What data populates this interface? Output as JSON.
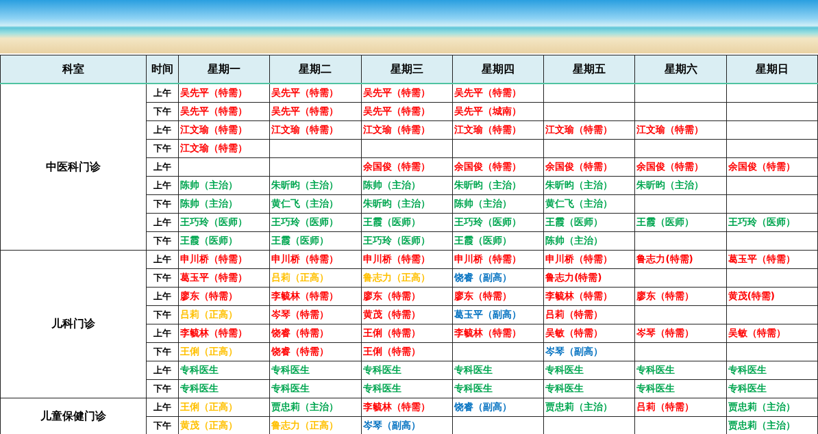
{
  "table": {
    "columns": [
      "科室",
      "时间",
      "星期一",
      "星期二",
      "星期三",
      "星期四",
      "星期五",
      "星期六",
      "星期日"
    ],
    "departments": [
      {
        "name": "中医科门诊",
        "rows": [
          {
            "time": "上午",
            "cells": [
              {
                "text": "吴先平（特需）",
                "color": "#ff0000"
              },
              {
                "text": "吴先平（特需）",
                "color": "#ff0000"
              },
              {
                "text": "吴先平（特需）",
                "color": "#ff0000"
              },
              {
                "text": "吴先平（特需）",
                "color": "#ff0000"
              },
              null,
              null,
              null
            ]
          },
          {
            "time": "下午",
            "cells": [
              {
                "text": "吴先平（特需）",
                "color": "#ff0000"
              },
              {
                "text": "吴先平（特需）",
                "color": "#ff0000"
              },
              {
                "text": "吴先平（特需）",
                "color": "#ff0000"
              },
              {
                "text": "吴先平（城南）",
                "color": "#ff0000"
              },
              null,
              null,
              null
            ]
          },
          {
            "time": "上午",
            "cells": [
              {
                "text": "江文瑜（特需）",
                "color": "#ff0000"
              },
              {
                "text": "江文瑜（特需）",
                "color": "#ff0000"
              },
              {
                "text": "江文瑜（特需）",
                "color": "#ff0000"
              },
              {
                "text": "江文瑜（特需）",
                "color": "#ff0000"
              },
              {
                "text": "江文瑜（特需）",
                "color": "#ff0000"
              },
              {
                "text": "江文瑜（特需）",
                "color": "#ff0000"
              },
              null
            ]
          },
          {
            "time": "下午",
            "cells": [
              {
                "text": "江文瑜（特需）",
                "color": "#ff0000"
              },
              null,
              null,
              null,
              null,
              null,
              null
            ]
          },
          {
            "time": "上午",
            "cells": [
              null,
              null,
              {
                "text": "余国俊（特需）",
                "color": "#ff0000"
              },
              {
                "text": "余国俊（特需）",
                "color": "#ff0000"
              },
              {
                "text": "余国俊（特需）",
                "color": "#ff0000"
              },
              {
                "text": "余国俊（特需）",
                "color": "#ff0000"
              },
              {
                "text": "余国俊（特需）",
                "color": "#ff0000"
              }
            ]
          },
          {
            "time": "上午",
            "cells": [
              {
                "text": "陈帅（主治）",
                "color": "#00a650"
              },
              {
                "text": "朱昕昀（主治）",
                "color": "#00a650"
              },
              {
                "text": "陈帅（主治）",
                "color": "#00a650"
              },
              {
                "text": "朱昕昀（主治）",
                "color": "#00a650"
              },
              {
                "text": "朱昕昀（主治）",
                "color": "#00a650"
              },
              {
                "text": "朱昕昀（主治）",
                "color": "#00a650"
              },
              null
            ]
          },
          {
            "time": "下午",
            "cells": [
              {
                "text": "陈帅（主治）",
                "color": "#00a650"
              },
              {
                "text": "黄仁飞（主治）",
                "color": "#00a650"
              },
              {
                "text": "朱昕昀（主治）",
                "color": "#00a650"
              },
              {
                "text": "陈帅（主治）",
                "color": "#00a650"
              },
              {
                "text": "黄仁飞（主治）",
                "color": "#00a650"
              },
              null,
              null
            ]
          },
          {
            "time": "上午",
            "cells": [
              {
                "text": "王巧玲（医师）",
                "color": "#00a650"
              },
              {
                "text": "王巧玲（医师）",
                "color": "#00a650"
              },
              {
                "text": "王霞（医师）",
                "color": "#00a650"
              },
              {
                "text": "王巧玲（医师）",
                "color": "#00a650"
              },
              {
                "text": "王霞（医师）",
                "color": "#00a650"
              },
              {
                "text": "王霞（医师）",
                "color": "#00a650"
              },
              {
                "text": "王巧玲（医师）",
                "color": "#00a650"
              }
            ]
          },
          {
            "time": "下午",
            "cells": [
              {
                "text": "王霞（医师）",
                "color": "#00a650"
              },
              {
                "text": "王霞（医师）",
                "color": "#00a650"
              },
              {
                "text": "王巧玲（医师）",
                "color": "#00a650"
              },
              {
                "text": "王霞（医师）",
                "color": "#00a650"
              },
              {
                "text": "陈帅（主治）",
                "color": "#00a650"
              },
              null,
              null
            ]
          }
        ]
      },
      {
        "name": "儿科门诊",
        "rows": [
          {
            "time": "上午",
            "cells": [
              {
                "text": "申川桥（特需）",
                "color": "#ff0000"
              },
              {
                "text": "申川桥（特需）",
                "color": "#ff0000"
              },
              {
                "text": "申川桥（特需）",
                "color": "#ff0000"
              },
              {
                "text": "申川桥（特需）",
                "color": "#ff0000"
              },
              {
                "text": "申川桥（特需）",
                "color": "#ff0000"
              },
              {
                "text": "鲁志力(特需)",
                "color": "#ff0000"
              },
              {
                "text": "葛玉平（特需）",
                "color": "#ff0000"
              }
            ]
          },
          {
            "time": "下午",
            "cells": [
              {
                "text": "葛玉平（特需）",
                "color": "#ff0000"
              },
              {
                "text": "吕莉（正高）",
                "color": "#ffc000"
              },
              {
                "text": "鲁志力（正高）",
                "color": "#ffc000"
              },
              {
                "text": "饶睿（副高）",
                "color": "#0070c0"
              },
              {
                "text": "鲁志力(特需)",
                "color": "#ff0000"
              },
              null,
              null
            ]
          },
          {
            "time": "上午",
            "cells": [
              {
                "text": "廖东（特需）",
                "color": "#ff0000"
              },
              {
                "text": "李毓林（特需）",
                "color": "#ff0000"
              },
              {
                "text": "廖东（特需）",
                "color": "#ff0000"
              },
              {
                "text": "廖东（特需）",
                "color": "#ff0000"
              },
              {
                "text": "李毓林（特需）",
                "color": "#ff0000"
              },
              {
                "text": "廖东（特需）",
                "color": "#ff0000"
              },
              {
                "text": "黄茂(特需)",
                "color": "#ff0000"
              }
            ]
          },
          {
            "time": "下午",
            "cells": [
              {
                "text": "吕莉（正高）",
                "color": "#ffc000"
              },
              {
                "text": "岑琴（特需）",
                "color": "#ff0000"
              },
              {
                "text": "黄茂（特需）",
                "color": "#ff0000"
              },
              {
                "text": "葛玉平（副高）",
                "color": "#0070c0"
              },
              {
                "text": "吕莉（特需）",
                "color": "#ff0000"
              },
              null,
              null
            ]
          },
          {
            "time": "上午",
            "cells": [
              {
                "text": "李毓林（特需）",
                "color": "#ff0000"
              },
              {
                "text": "饶睿（特需）",
                "color": "#ff0000"
              },
              {
                "text": "王俐（特需）",
                "color": "#ff0000"
              },
              {
                "text": "李毓林（特需）",
                "color": "#ff0000"
              },
              {
                "text": "吴敏（特需）",
                "color": "#ff0000"
              },
              {
                "text": "岑琴（特需）",
                "color": "#ff0000"
              },
              {
                "text": "吴敏（特需）",
                "color": "#ff0000"
              }
            ]
          },
          {
            "time": "下午",
            "cells": [
              {
                "text": "王俐（正高）",
                "color": "#ffc000"
              },
              {
                "text": "饶睿（特需）",
                "color": "#ff0000"
              },
              {
                "text": "王俐（特需）",
                "color": "#ff0000"
              },
              null,
              {
                "text": "岑琴（副高）",
                "color": "#0070c0"
              },
              null,
              null
            ]
          },
          {
            "time": "上午",
            "cells": [
              {
                "text": "专科医生",
                "color": "#00a650"
              },
              {
                "text": "专科医生",
                "color": "#00a650"
              },
              {
                "text": "专科医生",
                "color": "#00a650"
              },
              {
                "text": "专科医生",
                "color": "#00a650"
              },
              {
                "text": "专科医生",
                "color": "#00a650"
              },
              {
                "text": "专科医生",
                "color": "#00a650"
              },
              {
                "text": "专科医生",
                "color": "#00a650"
              }
            ]
          },
          {
            "time": "下午",
            "cells": [
              {
                "text": "专科医生",
                "color": "#00a650"
              },
              {
                "text": "专科医生",
                "color": "#00a650"
              },
              {
                "text": "专科医生",
                "color": "#00a650"
              },
              {
                "text": "专科医生",
                "color": "#00a650"
              },
              {
                "text": "专科医生",
                "color": "#00a650"
              },
              {
                "text": "专科医生",
                "color": "#00a650"
              },
              {
                "text": "专科医生",
                "color": "#00a650"
              }
            ]
          }
        ]
      },
      {
        "name": "儿童保健门诊",
        "rows": [
          {
            "time": "上午",
            "cells": [
              {
                "text": "王俐（正高）",
                "color": "#ffc000"
              },
              {
                "text": "贾忠莉（主治）",
                "color": "#00a650"
              },
              {
                "text": "李毓林（特需）",
                "color": "#ff0000"
              },
              {
                "text": "饶睿（副高）",
                "color": "#0070c0"
              },
              {
                "text": "贾忠莉（主治）",
                "color": "#00a650"
              },
              {
                "text": "吕莉（特需）",
                "color": "#ff0000"
              },
              {
                "text": "贾忠莉（主治）",
                "color": "#00a650"
              }
            ]
          },
          {
            "time": "下午",
            "cells": [
              {
                "text": "黄茂（正高）",
                "color": "#ffc000"
              },
              {
                "text": "鲁志力（正高）",
                "color": "#ffc000"
              },
              {
                "text": "岑琴（副高）",
                "color": "#0070c0"
              },
              null,
              null,
              null,
              {
                "text": "贾忠莉（主治）",
                "color": "#00a650"
              }
            ]
          }
        ]
      }
    ]
  }
}
